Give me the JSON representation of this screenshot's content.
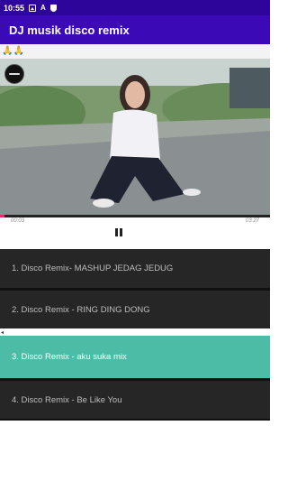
{
  "status_bar": {
    "time": "10:55",
    "icons": [
      "image-icon",
      "translate-a-icon",
      "shield-icon"
    ],
    "a_glyph": "A"
  },
  "app": {
    "title": "DJ musik disco remix"
  },
  "note": {
    "emoji": "🙏🙏"
  },
  "player": {
    "current_time": "00:03",
    "duration": "03:27",
    "progress_fraction": 0.015,
    "state": "playing",
    "accent_color": "#d6336c"
  },
  "playlist": {
    "active_color": "#4cbca7",
    "background_color": "#262626",
    "tracks": [
      {
        "label": "1. Disco Remix- MASHUP JEDAG JEDUG",
        "active": false
      },
      {
        "label": "2. Disco Remix - RING DING DONG",
        "active": false
      },
      {
        "label": "3. Disco Remix - aku suka mix",
        "active": true
      },
      {
        "label": "4. Disco Remix - Be Like You",
        "active": false
      }
    ]
  },
  "colors": {
    "status_bar": "#2e059a",
    "app_bar": "#3b0ab6"
  }
}
